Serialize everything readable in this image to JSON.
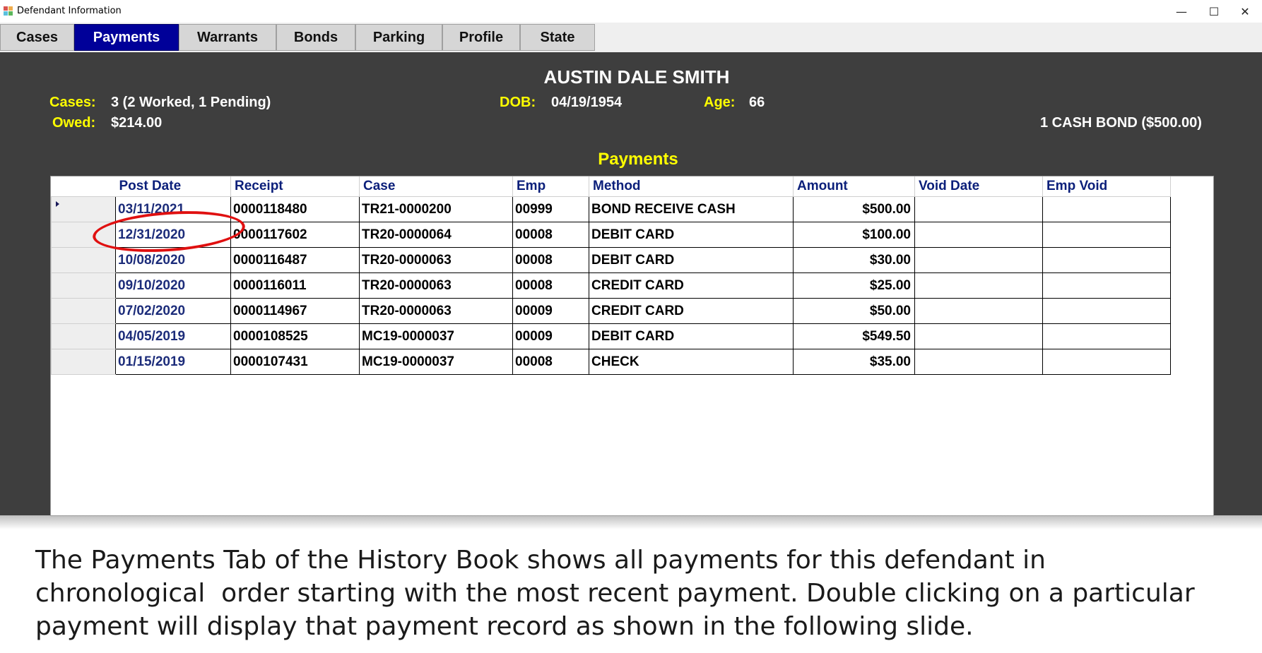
{
  "window": {
    "title": "Defendant Information",
    "minimize_label": "—",
    "maximize_label": "☐",
    "close_label": "✕"
  },
  "tabs": [
    {
      "label": "Cases",
      "active": false
    },
    {
      "label": "Payments",
      "active": true
    },
    {
      "label": "Warrants",
      "active": false
    },
    {
      "label": "Bonds",
      "active": false
    },
    {
      "label": "Parking",
      "active": false
    },
    {
      "label": "Profile",
      "active": false
    },
    {
      "label": "State",
      "active": false
    }
  ],
  "defendant": {
    "name": "AUSTIN DALE SMITH",
    "cases_label": "Cases:",
    "cases_value": "3 (2 Worked, 1 Pending)",
    "owed_label": "Owed:",
    "owed_value": "$214.00",
    "dob_label": "DOB:",
    "dob_value": "04/19/1954",
    "age_label": "Age:",
    "age_value": "66",
    "bond_summary": "1 CASH BOND ($500.00)"
  },
  "payments": {
    "title": "Payments",
    "columns": [
      "Post Date",
      "Receipt",
      "Case",
      "Emp",
      "Method",
      "Amount",
      "Void Date",
      "Emp Void"
    ],
    "rows": [
      {
        "post_date": "03/11/2021",
        "receipt": "0000118480",
        "case": "TR21-0000200",
        "emp": "00999",
        "method": "BOND RECEIVE CASH",
        "amount": "$500.00",
        "void_date": "",
        "emp_void": ""
      },
      {
        "post_date": "12/31/2020",
        "receipt": "0000117602",
        "case": "TR20-0000064",
        "emp": "00008",
        "method": "DEBIT CARD",
        "amount": "$100.00",
        "void_date": "",
        "emp_void": ""
      },
      {
        "post_date": "10/08/2020",
        "receipt": "0000116487",
        "case": "TR20-0000063",
        "emp": "00008",
        "method": "DEBIT CARD",
        "amount": "$30.00",
        "void_date": "",
        "emp_void": ""
      },
      {
        "post_date": "09/10/2020",
        "receipt": "0000116011",
        "case": "TR20-0000063",
        "emp": "00008",
        "method": "CREDIT CARD",
        "amount": "$25.00",
        "void_date": "",
        "emp_void": ""
      },
      {
        "post_date": "07/02/2020",
        "receipt": "0000114967",
        "case": "TR20-0000063",
        "emp": "00009",
        "method": "CREDIT CARD",
        "amount": "$50.00",
        "void_date": "",
        "emp_void": ""
      },
      {
        "post_date": "04/05/2019",
        "receipt": "0000108525",
        "case": "MC19-0000037",
        "emp": "00009",
        "method": "DEBIT CARD",
        "amount": "$549.50",
        "void_date": "",
        "emp_void": ""
      },
      {
        "post_date": "01/15/2019",
        "receipt": "0000107431",
        "case": "MC19-0000037",
        "emp": "00008",
        "method": "CHECK",
        "amount": "$35.00",
        "void_date": "",
        "emp_void": ""
      }
    ]
  },
  "caption": {
    "lines": [
      "The Payments Tab of the History Book shows all payments for this defendant in",
      "chronological  order starting with the most recent payment. Double clicking on a particular",
      "payment will display that payment record as shown in the following slide."
    ]
  },
  "colors": {
    "active_tab": "#000099",
    "panel_bg": "#3e3e3e",
    "label_yellow": "#ffff00",
    "header_blue": "#0b1f7a",
    "highlight_circle": "#e01010"
  }
}
